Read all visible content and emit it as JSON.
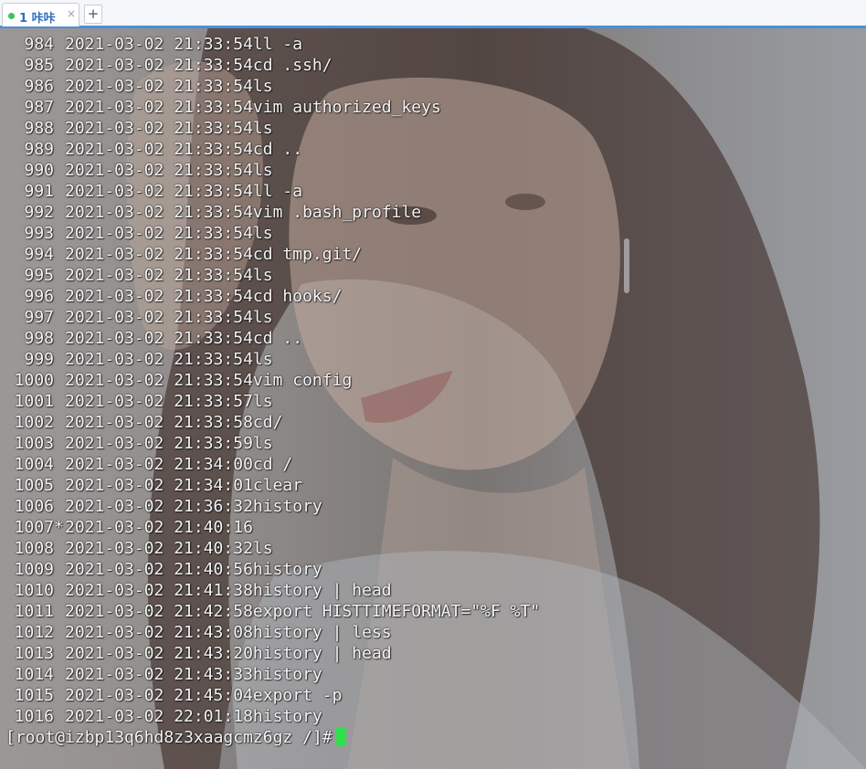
{
  "tabs": [
    {
      "label": "1 咔咔",
      "status_color": "#3cc35a",
      "close_label": "×"
    }
  ],
  "new_tab_label": "+",
  "terminal": {
    "history": [
      {
        "num": "984",
        "flag": "",
        "timestamp": "2021-03-02 21:33:54",
        "command": "ll -a"
      },
      {
        "num": "985",
        "flag": "",
        "timestamp": "2021-03-02 21:33:54",
        "command": "cd .ssh/"
      },
      {
        "num": "986",
        "flag": "",
        "timestamp": "2021-03-02 21:33:54",
        "command": "ls"
      },
      {
        "num": "987",
        "flag": "",
        "timestamp": "2021-03-02 21:33:54",
        "command": "vim authorized_keys"
      },
      {
        "num": "988",
        "flag": "",
        "timestamp": "2021-03-02 21:33:54",
        "command": "ls"
      },
      {
        "num": "989",
        "flag": "",
        "timestamp": "2021-03-02 21:33:54",
        "command": "cd .."
      },
      {
        "num": "990",
        "flag": "",
        "timestamp": "2021-03-02 21:33:54",
        "command": "ls"
      },
      {
        "num": "991",
        "flag": "",
        "timestamp": "2021-03-02 21:33:54",
        "command": "ll -a"
      },
      {
        "num": "992",
        "flag": "",
        "timestamp": "2021-03-02 21:33:54",
        "command": "vim .bash_profile"
      },
      {
        "num": "993",
        "flag": "",
        "timestamp": "2021-03-02 21:33:54",
        "command": "ls"
      },
      {
        "num": "994",
        "flag": "",
        "timestamp": "2021-03-02 21:33:54",
        "command": "cd tmp.git/"
      },
      {
        "num": "995",
        "flag": "",
        "timestamp": "2021-03-02 21:33:54",
        "command": "ls"
      },
      {
        "num": "996",
        "flag": "",
        "timestamp": "2021-03-02 21:33:54",
        "command": "cd hooks/"
      },
      {
        "num": "997",
        "flag": "",
        "timestamp": "2021-03-02 21:33:54",
        "command": "ls"
      },
      {
        "num": "998",
        "flag": "",
        "timestamp": "2021-03-02 21:33:54",
        "command": "cd .."
      },
      {
        "num": "999",
        "flag": "",
        "timestamp": "2021-03-02 21:33:54",
        "command": "ls"
      },
      {
        "num": "1000",
        "flag": "",
        "timestamp": "2021-03-02 21:33:54",
        "command": "vim config"
      },
      {
        "num": "1001",
        "flag": "",
        "timestamp": "2021-03-02 21:33:57",
        "command": "ls"
      },
      {
        "num": "1002",
        "flag": "",
        "timestamp": "2021-03-02 21:33:58",
        "command": "cd/"
      },
      {
        "num": "1003",
        "flag": "",
        "timestamp": "2021-03-02 21:33:59",
        "command": "ls"
      },
      {
        "num": "1004",
        "flag": "",
        "timestamp": "2021-03-02 21:34:00",
        "command": "cd /"
      },
      {
        "num": "1005",
        "flag": "",
        "timestamp": "2021-03-02 21:34:01",
        "command": "clear"
      },
      {
        "num": "1006",
        "flag": "",
        "timestamp": "2021-03-02 21:36:32",
        "command": "history"
      },
      {
        "num": "1007",
        "flag": "*",
        "timestamp": "2021-03-02 21:40:16",
        "command": ""
      },
      {
        "num": "1008",
        "flag": "",
        "timestamp": "2021-03-02 21:40:32",
        "command": "ls"
      },
      {
        "num": "1009",
        "flag": "",
        "timestamp": "2021-03-02 21:40:56",
        "command": "history"
      },
      {
        "num": "1010",
        "flag": "",
        "timestamp": "2021-03-02 21:41:38",
        "command": "history | head"
      },
      {
        "num": "1011",
        "flag": "",
        "timestamp": "2021-03-02 21:42:58",
        "command": "export HISTTIMEFORMAT=\"%F %T\""
      },
      {
        "num": "1012",
        "flag": "",
        "timestamp": "2021-03-02 21:43:08",
        "command": "history | less"
      },
      {
        "num": "1013",
        "flag": "",
        "timestamp": "2021-03-02 21:43:20",
        "command": "history | head"
      },
      {
        "num": "1014",
        "flag": "",
        "timestamp": "2021-03-02 21:43:33",
        "command": "history"
      },
      {
        "num": "1015",
        "flag": "",
        "timestamp": "2021-03-02 21:45:04",
        "command": "export -p"
      },
      {
        "num": "1016",
        "flag": "",
        "timestamp": "2021-03-02 22:01:18",
        "command": "history"
      }
    ],
    "prompt": "[root@izbp13q6hd8z3xaagcmz6gz /]#",
    "cursor_color": "#2ee04a",
    "text_color": "#f4f4f4"
  }
}
